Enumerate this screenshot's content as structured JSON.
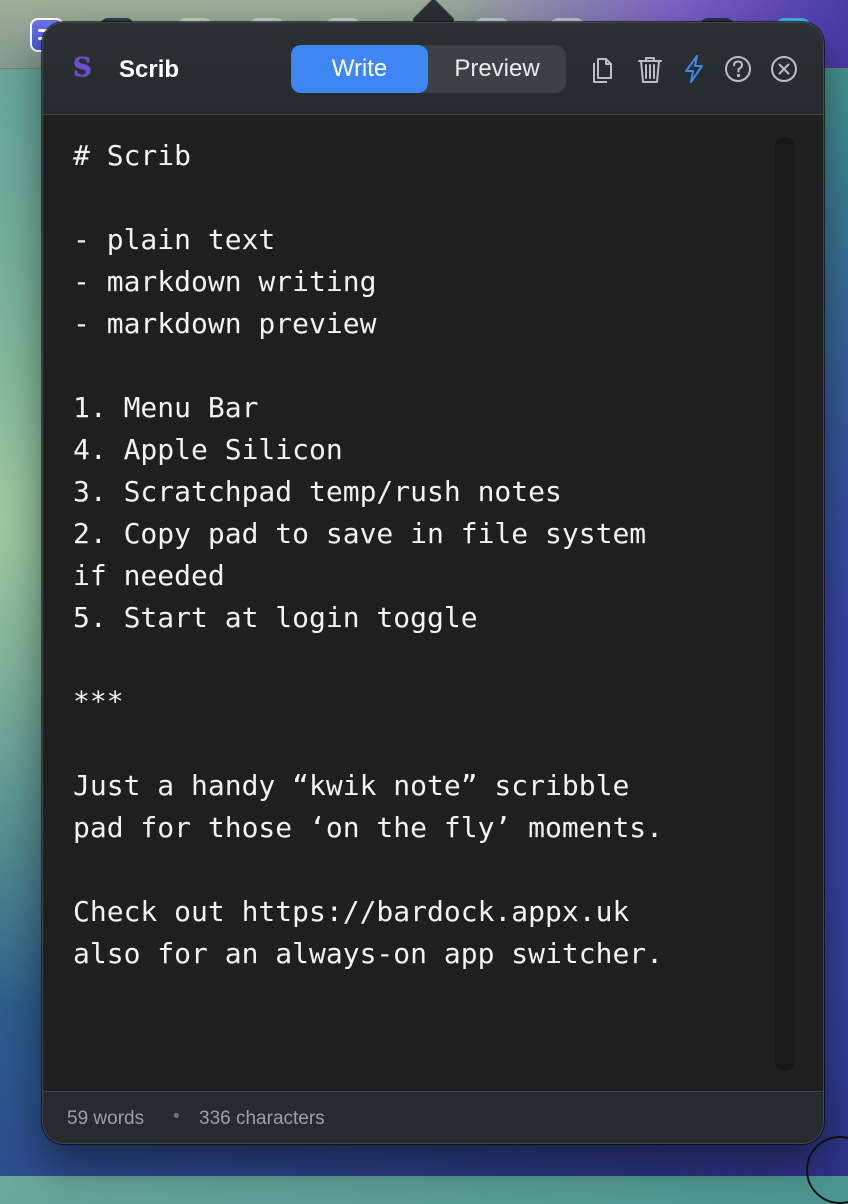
{
  "app": {
    "title": "Scrib",
    "logo_letter": "S",
    "accent_color": "#3f86f5",
    "logo_color": "#6f4bd8"
  },
  "menubar": {
    "icons": [
      "scrib-menu-icon",
      "app-icon",
      "app-icon",
      "app-icon",
      "app-icon",
      "app-icon",
      "app-icon",
      "app-icon",
      "app-icon"
    ]
  },
  "tabs": {
    "write_label": "Write",
    "preview_label": "Preview",
    "active": "Write"
  },
  "toolbar": {
    "icons": [
      "copy-icon",
      "trash-icon",
      "lightning-icon",
      "help-icon",
      "close-icon"
    ]
  },
  "editor": {
    "content": "# Scrib\n\n- plain text\n- markdown writing\n- markdown preview\n\n1. Menu Bar\n4. Apple Silicon\n3. Scratchpad temp/rush notes\n2. Copy pad to save in file system\nif needed\n5. Start at login toggle\n\n***\n\nJust a handy “kwik note” scribble\npad for those ‘on the fly’ moments.\n\nCheck out https://bardock.appx.uk\nalso for an always-on app switcher."
  },
  "footer": {
    "words": "59 words",
    "separator": "•",
    "characters": "336 characters"
  }
}
